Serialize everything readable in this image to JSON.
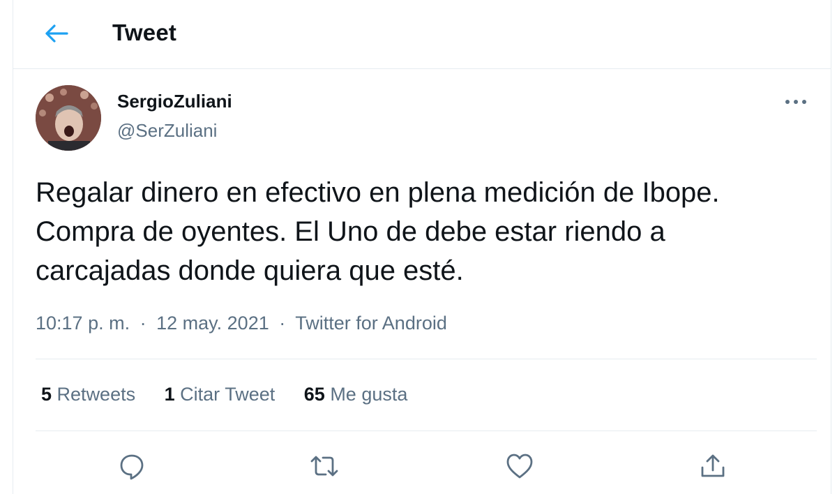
{
  "header": {
    "title": "Tweet"
  },
  "colors": {
    "accent": "#1da1f2",
    "secondary_text": "#5b7083",
    "divider": "#e6ecf0"
  },
  "tweet": {
    "display_name": "SergioZuliani",
    "handle": "@SerZuliani",
    "text_lines": [
      "Regalar dinero en efectivo en plena medición de Ibope.",
      "Compra de oyentes. El Uno de debe estar riendo a",
      "carcajadas donde quiera que esté."
    ],
    "time": "10:17 p. m.",
    "date": "12 may. 2021",
    "source": "Twitter for Android",
    "separator": "·"
  },
  "stats": {
    "retweets": {
      "count": "5",
      "label": "Retweets"
    },
    "quotes": {
      "count": "1",
      "label": "Citar Tweet"
    },
    "likes": {
      "count": "65",
      "label": "Me gusta"
    }
  },
  "actions": [
    "reply-icon",
    "retweet-icon",
    "like-icon",
    "share-icon"
  ]
}
